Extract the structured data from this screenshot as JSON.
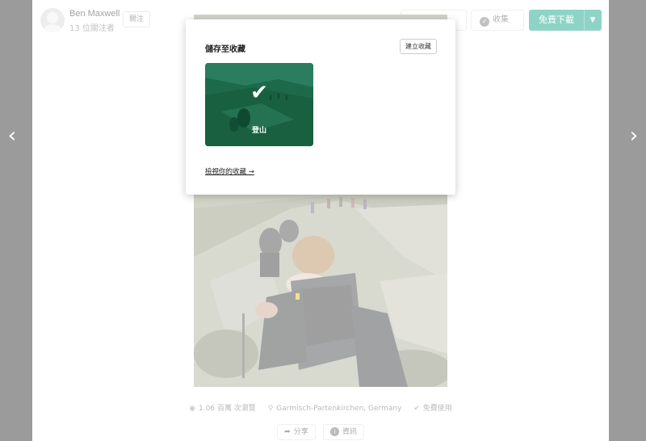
{
  "author": {
    "name": "Ben Maxwell",
    "followers": "13 位關注者",
    "follow_label": "關注"
  },
  "toolbar": {
    "like_label": "",
    "collect_label": "收集",
    "download_label": "免費下載"
  },
  "popover": {
    "title": "儲存至收藏",
    "create_label": "建立收藏",
    "collections": [
      {
        "name": "登山",
        "selected": true
      }
    ],
    "view_link": "檢視你的收藏 →"
  },
  "meta": {
    "views": "1.06 百萬 次瀏覽",
    "location": "Garmisch-Partenkirchen, Germany",
    "license": "免費使用"
  },
  "actions": {
    "share_label": "分享",
    "info_label": "資訊"
  },
  "colors": {
    "accent": "#05a081",
    "backdrop": "#9b9b9b"
  }
}
